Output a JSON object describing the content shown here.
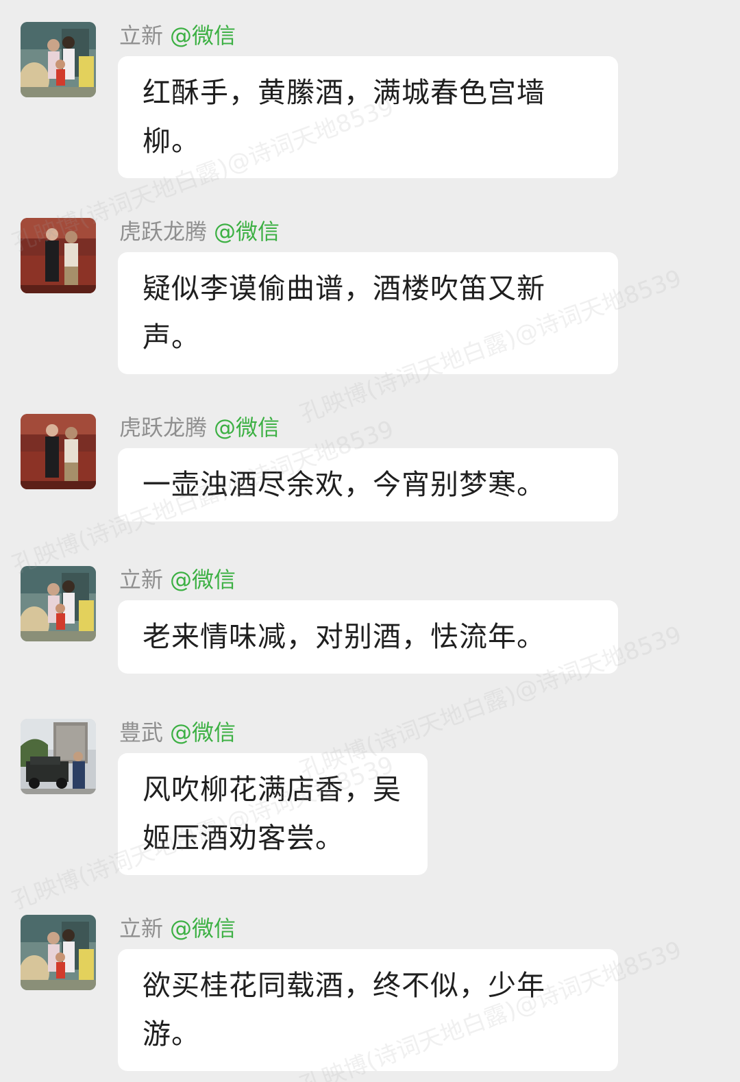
{
  "watermark": "孔映博(诗词天地白露)@诗词天地8539",
  "messages": [
    {
      "sender": "立新",
      "tag": "@微信",
      "avatar": "family-photo-avatar",
      "text": "红酥手，黄縢酒，满城春色宫墙柳。"
    },
    {
      "sender": "虎跃龙腾",
      "tag": "@微信",
      "avatar": "two-men-photo-avatar",
      "text": "疑似李谟偷曲谱，酒楼吹笛又新声。"
    },
    {
      "sender": "虎跃龙腾",
      "tag": "@微信",
      "avatar": "two-men-photo-avatar",
      "text": "一壶浊酒尽余欢，今宵别梦寒。"
    },
    {
      "sender": "立新",
      "tag": "@微信",
      "avatar": "family-photo-avatar",
      "text": "老来情味减，对别酒，怯流年。"
    },
    {
      "sender": "豊武",
      "tag": "@微信",
      "avatar": "jeep-photo-avatar",
      "text": "风吹柳花满店香，吴姬压酒劝客尝。"
    },
    {
      "sender": "立新",
      "tag": "@微信",
      "avatar": "family-photo-avatar",
      "text": "欲买桂花同载酒，终不似，少年游。"
    }
  ]
}
